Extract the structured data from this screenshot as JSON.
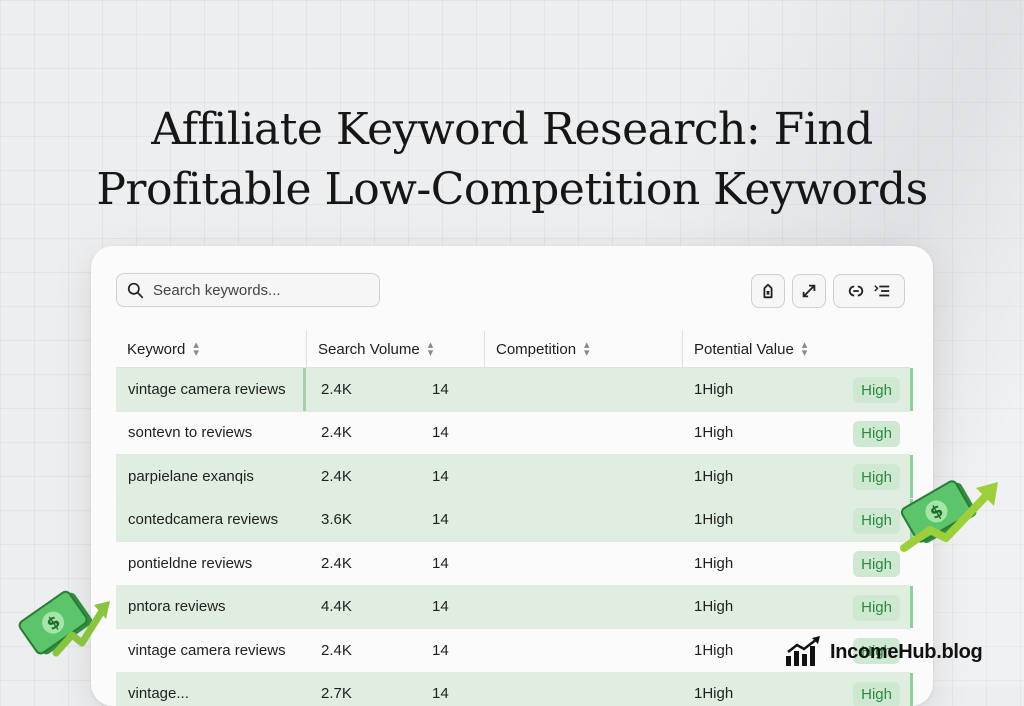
{
  "title": {
    "line1": "Affiliate Keyword Research: Find",
    "line2": "Profitable Low-Competition Keywords"
  },
  "search": {
    "placeholder": "Search keywords..."
  },
  "toolbar": {
    "icons": [
      "tag-icon",
      "expand-icon",
      "link-icon",
      "menu-list-icon"
    ]
  },
  "table": {
    "columns": [
      "Keyword",
      "Search Volume",
      "Competition",
      "Potential Value"
    ],
    "rows": [
      {
        "keyword": "vintage camera reviews",
        "volume": "2.4K",
        "competition": "14",
        "potential": "1High",
        "badge": "High"
      },
      {
        "keyword": "sontevn to reviews",
        "volume": "2.4K",
        "competition": "14",
        "potential": "1High",
        "badge": "High"
      },
      {
        "keyword": "parpielane exanqis",
        "volume": "2.4K",
        "competition": "14",
        "potential": "1High",
        "badge": "High"
      },
      {
        "keyword": "contedcamera reviews",
        "volume": "3.6K",
        "competition": "14",
        "potential": "1High",
        "badge": "High"
      },
      {
        "keyword": "pontieldne reviews",
        "volume": "2.4K",
        "competition": "14",
        "potential": "1High",
        "badge": "High"
      },
      {
        "keyword": "pntora reviews",
        "volume": "4.4K",
        "competition": "14",
        "potential": "1High",
        "badge": "High"
      },
      {
        "keyword": "vintage camera reviews",
        "volume": "2.4K",
        "competition": "14",
        "potential": "1High",
        "badge": "High"
      },
      {
        "keyword": "vintage...",
        "volume": "2.7K",
        "competition": "14",
        "potential": "1High",
        "badge": "High"
      }
    ]
  },
  "brand": {
    "name": "IncomeHub.blog"
  },
  "colors": {
    "accent_green": "#2b8a3e",
    "row_green": "#dfeee0",
    "badge_bg": "#cfe8d2"
  }
}
